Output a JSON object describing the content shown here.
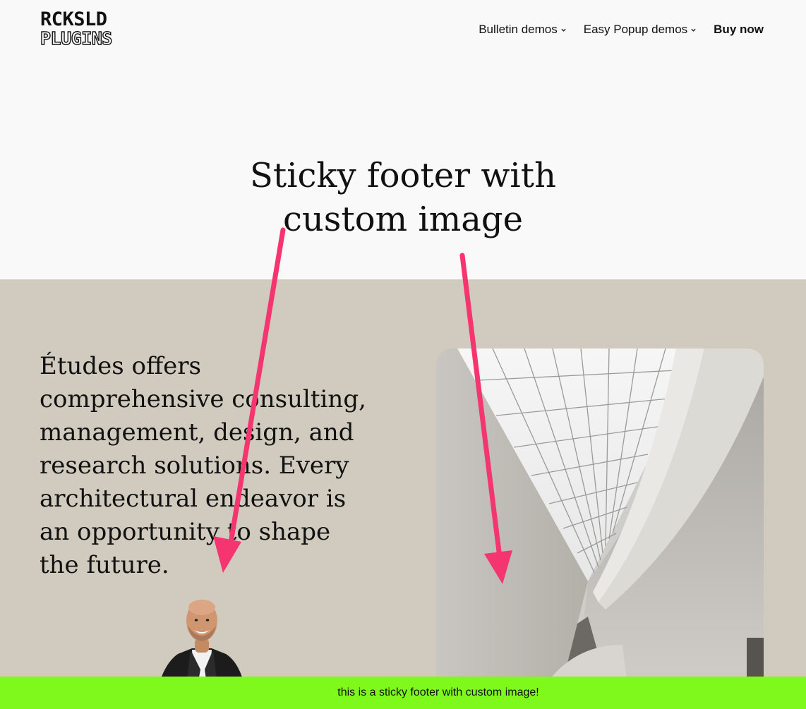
{
  "brand": {
    "logo_line1": "RCKSLD",
    "logo_line2": "PLUGINS"
  },
  "nav": {
    "items": [
      {
        "label": "Bulletin demos",
        "has_dropdown": true
      },
      {
        "label": "Easy Popup demos",
        "has_dropdown": true
      },
      {
        "label": "Buy now",
        "has_dropdown": false
      }
    ],
    "icons": {
      "dropdown": "chevron-down-icon"
    }
  },
  "hero": {
    "title": "Sticky footer with custom image"
  },
  "section": {
    "text": "Études offers comprehensive consulting, management, design, and research solutions. Every architectural endeavor is an opportunity to shape the future."
  },
  "sticky_footer": {
    "text": "this is a sticky footer with custom image!"
  },
  "colors": {
    "page_background": "#f9f9f9",
    "section_background": "#d1cbbf",
    "footer_background": "#7ff81c",
    "arrow": "#f5356f"
  }
}
